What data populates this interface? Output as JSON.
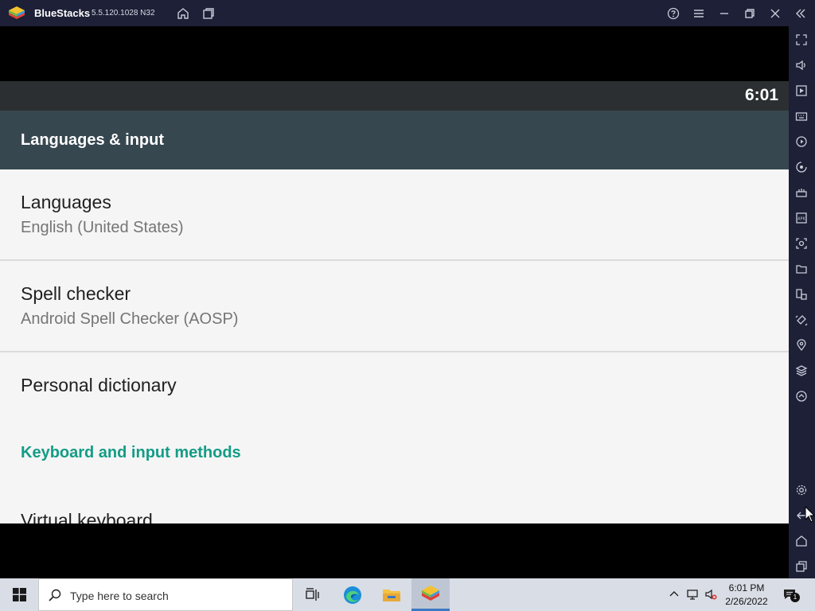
{
  "window": {
    "app_name": "BlueStacks",
    "version": "5.5.120.1028  N32",
    "icons": [
      "bluestacks-logo-icon",
      "home-icon",
      "multi-instance-icon",
      "help-icon",
      "menu-icon",
      "minimize-icon",
      "restore-icon",
      "close-icon",
      "collapse-sidebar-icon"
    ]
  },
  "android": {
    "status_bar": {
      "time": "6:01"
    },
    "app_bar": {
      "title": "Languages & input"
    },
    "preferences": [
      {
        "title": "Languages",
        "summary": "English (United States)"
      },
      {
        "title": "Spell checker",
        "summary": "Android Spell Checker (AOSP)"
      },
      {
        "title": "Personal dictionary"
      }
    ],
    "category": "Keyboard and input methods",
    "next_item": "Virtual keyboard"
  },
  "sidebar": {
    "icons": [
      "fullscreen-icon",
      "volume-icon",
      "media-manager-icon",
      "keyboard-controls-icon",
      "macro-recorder-icon",
      "sync-icon",
      "install-apk-icon",
      "apk-icon",
      "screenshot-icon",
      "folder-icon",
      "multi-instance-sync-icon",
      "rotate-icon",
      "location-icon",
      "layers-icon",
      "eco-mode-icon",
      "settings-icon",
      "back-icon",
      "home-icon",
      "recent-apps-icon"
    ]
  },
  "taskbar": {
    "search_placeholder": "Type here to search",
    "apps": [
      "task-view-icon",
      "edge-icon",
      "file-explorer-icon",
      "bluestacks-icon"
    ],
    "clock": {
      "time": "6:01 PM",
      "date": "2/26/2022"
    },
    "notification_count": "1"
  },
  "colors": {
    "title_bar": "#1d2036",
    "android_app_bar": "#37474f",
    "category_accent": "#149c86",
    "taskbar": "#d9dde6"
  }
}
